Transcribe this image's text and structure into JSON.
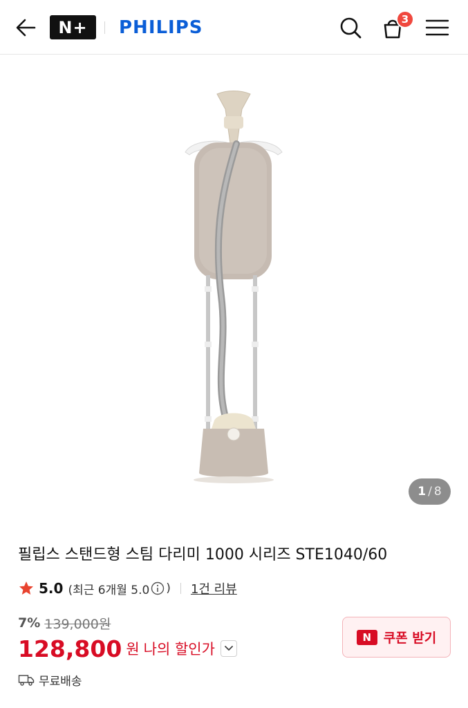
{
  "header": {
    "logo_badge": "N+",
    "brand": "PHILIPS",
    "cart_count": "3"
  },
  "gallery": {
    "current": "1",
    "separator": "/",
    "total": "8"
  },
  "product": {
    "title": "필립스 스탠드형 스팀 다리미 1000 시리즈 STE1040/60",
    "rating_score": "5.0",
    "rating_recent_prefix": "(최근 6개월 5.0",
    "rating_recent_suffix": ")",
    "review_link": "1건 리뷰",
    "discount": "7%",
    "original_price": "139,000원",
    "sale_price": "128,800",
    "currency": "원",
    "my_discount_label": "나의 할인가",
    "coupon_logo": "N",
    "coupon_label": "쿠폰 받기",
    "shipping": "무료배송"
  },
  "colors": {
    "brand_blue": "#0b5ed7",
    "price_red": "#d80c24",
    "badge_red": "#f0483e",
    "star_red": "#e8432f"
  }
}
